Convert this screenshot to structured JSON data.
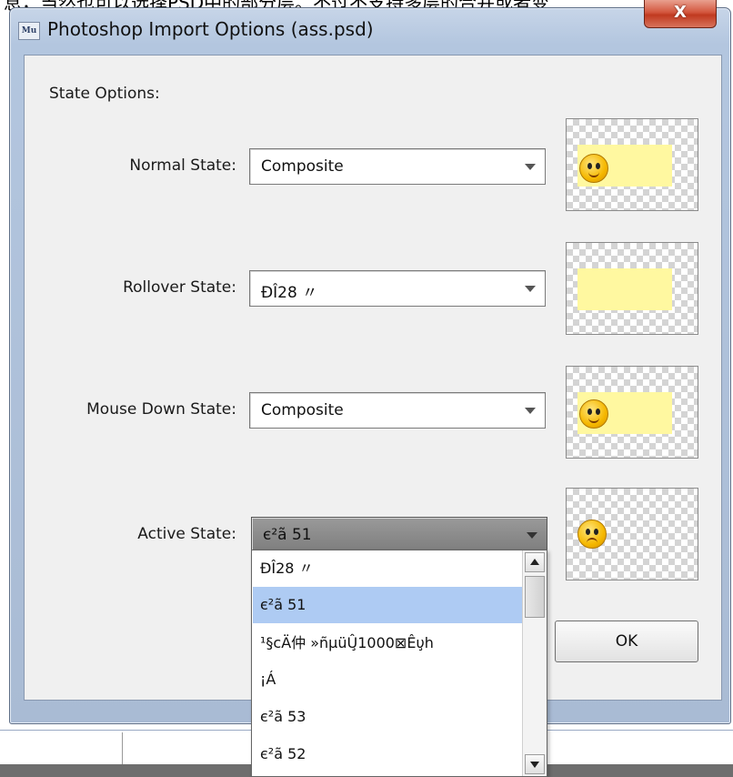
{
  "background_text": "息，当然也可以选择PSD中的部分层。不过不支持多层的合并或者变",
  "window": {
    "app_icon_text": "Mu",
    "title": "Photoshop Import Options (ass.psd)",
    "close_symbol": "X"
  },
  "section_label": "State Options:",
  "states": [
    {
      "label": "Normal State:",
      "value": "Composite"
    },
    {
      "label": "Rollover State:",
      "value": "ÐÎ28 〃"
    },
    {
      "label": "Mouse Down State:",
      "value": "Composite"
    },
    {
      "label": "Active State:",
      "value": "є²ã 51"
    }
  ],
  "dropdown": {
    "items": [
      "ÐÎ28 〃",
      "є²ã 51",
      "¹§cÄ仲 »ñμüÛ̧1000⊠Êυ̧h",
      "¡Á",
      "є²ã 53",
      "є²ã 52"
    ],
    "selected_index": 1
  },
  "ok_label": "OK",
  "colors": {
    "title_bar": "#b3c6df",
    "client_bg": "#f0f0f0",
    "selection": "#aecbf3",
    "preview_fill": "#fff8a0"
  }
}
